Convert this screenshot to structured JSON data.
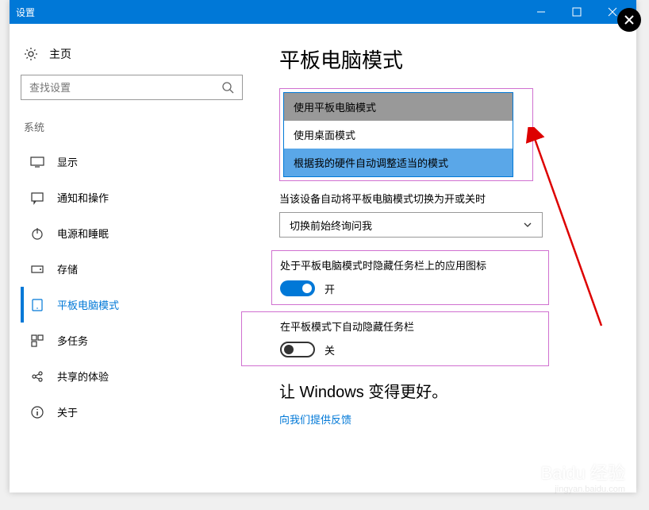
{
  "titlebar": {
    "title": "设置"
  },
  "sidebar": {
    "home": "主页",
    "search_placeholder": "查找设置",
    "category": "系统",
    "items": [
      {
        "label": "显示"
      },
      {
        "label": "通知和操作"
      },
      {
        "label": "电源和睡眠"
      },
      {
        "label": "存储"
      },
      {
        "label": "平板电脑模式"
      },
      {
        "label": "多任务"
      },
      {
        "label": "共享的体验"
      },
      {
        "label": "关于"
      }
    ]
  },
  "main": {
    "title": "平板电脑模式",
    "dropdown": {
      "options": [
        "使用平板电脑模式",
        "使用桌面模式",
        "根据我的硬件自动调整适当的模式"
      ]
    },
    "auto_switch_label": "当该设备自动将平板电脑模式切换为开或关时",
    "auto_switch_value": "切换前始终询问我",
    "hide_icons_label": "处于平板电脑模式时隐藏任务栏上的应用图标",
    "hide_icons_state": "开",
    "auto_hide_label": "在平板模式下自动隐藏任务栏",
    "auto_hide_state": "关",
    "improve_title": "让 Windows 变得更好。",
    "feedback_link": "向我们提供反馈"
  },
  "watermark": {
    "main": "Baidu 经验",
    "sub": "jingyan.baidu.com"
  }
}
